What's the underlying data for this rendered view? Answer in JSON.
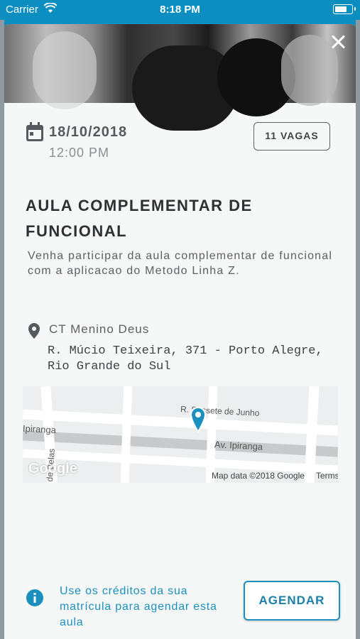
{
  "status_bar": {
    "carrier": "Carrier",
    "time": "8:18 PM"
  },
  "event": {
    "date": "18/10/2018",
    "time": "12:00 PM",
    "vacancies": "11 VAGAS",
    "title": "AULA COMPLEMENTAR DE FUNCIONAL",
    "description": "Venha participar da aula complementar de funcional com a aplicacao do Metodo Linha Z."
  },
  "location": {
    "name": "CT Menino Deus",
    "address": "R. Múcio Teixeira, 371 - Porto Alegre, Rio Grande do Sul"
  },
  "map": {
    "labels": {
      "street_top": "R. Sessete de Junho",
      "street_main": "Av. Ipiranga",
      "street_left": "Ipiranga",
      "street_vertical": "de Belas"
    },
    "logo": "Google",
    "attribution": "Map data ©2018 Google",
    "terms": "Terms"
  },
  "footer": {
    "info_text": "Use os créditos da sua matrícula para agendar esta aula",
    "button_label": "AGENDAR"
  },
  "colors": {
    "accent": "#1b90bf",
    "status_bar": "#0d8ec0"
  },
  "icons": {
    "close": "close-icon",
    "calendar": "calendar-icon",
    "location": "location-pin-icon",
    "info": "info-icon"
  }
}
